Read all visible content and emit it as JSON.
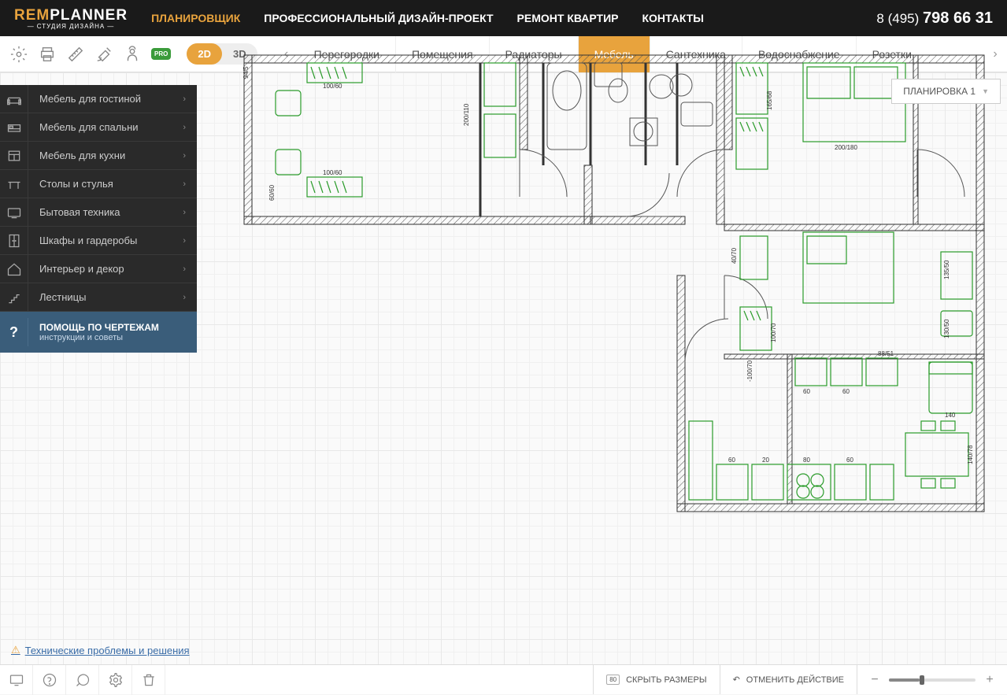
{
  "header": {
    "logo_rem": "REM",
    "logo_planner": "PLANNER",
    "logo_sub": "СТУДИЯ ДИЗАЙНА",
    "nav": [
      {
        "label": "ПЛАНИРОВЩИК",
        "active": true
      },
      {
        "label": "ПРОФЕССИОНАЛЬНЫЙ ДИЗАЙН-ПРОЕКТ",
        "active": false
      },
      {
        "label": "РЕМОНТ КВАРТИР",
        "active": false
      },
      {
        "label": "КОНТАКТЫ",
        "active": false
      }
    ],
    "phone_prefix": "8 (495) ",
    "phone_main": "798 66 31"
  },
  "toolbar": {
    "pro_label": "PRO",
    "view2d": "2D",
    "view3d": "3D",
    "tabs": [
      {
        "label": "Перегородки",
        "active": false
      },
      {
        "label": "Помещения",
        "active": false
      },
      {
        "label": "Радиаторы",
        "active": false
      },
      {
        "label": "Мебель",
        "active": true
      },
      {
        "label": "Сантехника",
        "active": false
      },
      {
        "label": "Водоснабжение",
        "active": false
      },
      {
        "label": "Розетки",
        "active": false
      }
    ]
  },
  "layout_dropdown": "ПЛАНИРОВКА 1",
  "sidebar": {
    "items": [
      {
        "label": "Мебель для гостиной",
        "icon": "sofa-icon"
      },
      {
        "label": "Мебель для спальни",
        "icon": "bed-icon"
      },
      {
        "label": "Мебель для кухни",
        "icon": "kitchen-icon"
      },
      {
        "label": "Столы и стулья",
        "icon": "table-icon"
      },
      {
        "label": "Бытовая техника",
        "icon": "tv-icon"
      },
      {
        "label": "Шкафы и гардеробы",
        "icon": "wardrobe-icon"
      },
      {
        "label": "Интерьер и декор",
        "icon": "house-icon"
      },
      {
        "label": "Лестницы",
        "icon": "stairs-icon"
      }
    ],
    "help_title": "ПОМОЩЬ ПО ЧЕРТЕЖАМ",
    "help_sub": "инструкции и советы"
  },
  "floor_plan": {
    "dimension_labels": [
      "94/5",
      "200/110",
      "100/60",
      "60/60",
      "100/60",
      "165/68",
      "200/180",
      "-100/70",
      "100/70",
      "40/70",
      "135/50",
      "130/50",
      "88/51",
      "60",
      "60",
      "140",
      "60",
      "20",
      "80",
      "60",
      "140/78"
    ]
  },
  "tech_link": "Технические проблемы и решения",
  "bottombar": {
    "hide_sizes": "СКРЫТЬ РАЗМЕРЫ",
    "hide_sizes_badge": "80",
    "undo": "ОТМЕНИТЬ ДЕЙСТВИЕ"
  }
}
